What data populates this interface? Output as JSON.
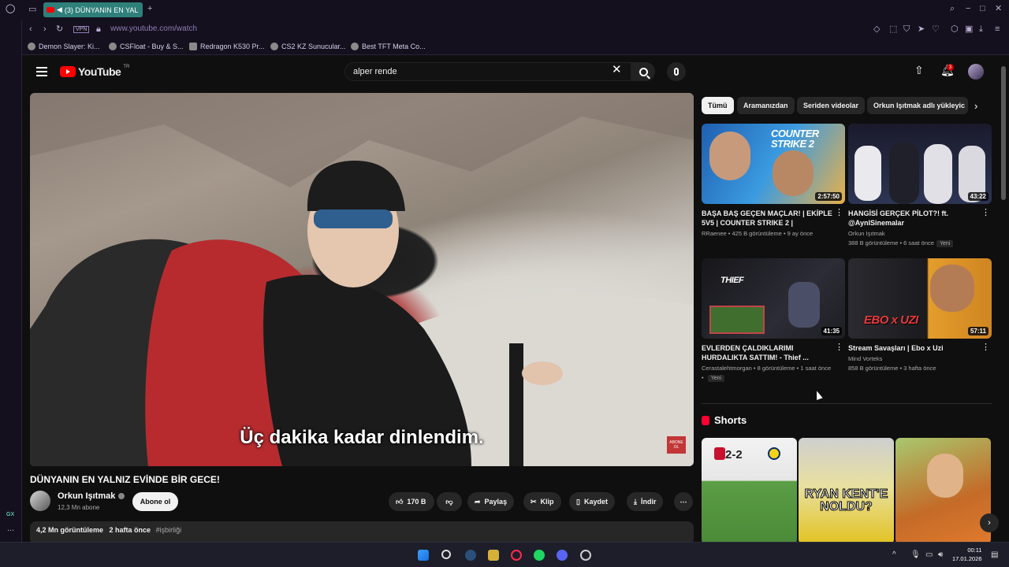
{
  "browser": {
    "tab_title": "(3) DÜNYANIN EN YAL",
    "address": "www.youtube.com/watch",
    "vpn_label": "VPN",
    "bookmarks": [
      "Demon Slayer: Ki...",
      "CSFloat - Buy & S...",
      "Redragon K530 Pr...",
      "CS2 KZ Sunucular...",
      "Best TFT Meta Co..."
    ],
    "gx_label": "GX",
    "more_label": "..."
  },
  "header": {
    "logo_text": "YouTube",
    "country": "TR",
    "search_value": "alper rende",
    "notif_count": "3"
  },
  "player": {
    "subtitle": "Üç dakika kadar dinlendim.",
    "watermark": "ABONE OL"
  },
  "video": {
    "title": "DÜNYANIN EN YALNIZ EVİNDE BİR GECE!",
    "channel": "Orkun Işıtmak",
    "subs": "12,3 Mn abone",
    "subscribe": "Abone ol",
    "likes": "170 B",
    "share": "Paylaş",
    "clip": "Klip",
    "save": "Kaydet",
    "download": "İndir",
    "views": "4,2 Mn görüntüleme",
    "age": "2 hafta önce",
    "tag": "#işbirliği"
  },
  "chips": [
    "Tümü",
    "Aramanızdan",
    "Seriden videolar",
    "Orkun Işıtmak adlı yükleyic"
  ],
  "recommendations": [
    {
      "title": "BAŞA BAŞ GEÇEN MAÇLAR! | EKİPLE 5V5 | COUNTER STRIKE 2 |",
      "channel": "RRaenee",
      "meta": "425 B görüntüleme • 9 ay önce",
      "duration": "2:57:50",
      "thumb_text": "COUNTER STRIKE 2",
      "badge": ""
    },
    {
      "title": "HANGİSİ GERÇEK PİLOT?! ft. @AynISinemalar",
      "channel": "Orkun Işıtmak",
      "meta": "388 B görüntüleme • 6 saat önce",
      "duration": "43:22",
      "thumb_text": "",
      "badge": "Yeni"
    },
    {
      "title": "EVLERDEN ÇALDIKLARIMI HURDALIKTA SATTIM! - Thief ...",
      "channel": "Cerastalehtmorgan",
      "meta": "8 görüntüleme • 1 saat önce",
      "duration": "41:35",
      "thumb_text": "THIEF",
      "badge": "Yeni"
    },
    {
      "title": "Stream Savaşları | Ebo x Uzi",
      "channel": "Mind Vorteks",
      "meta": "858 B görüntüleme • 3 hafta önce",
      "duration": "57:11",
      "thumb_text": "EBO x UZI",
      "badge": ""
    }
  ],
  "shorts": {
    "heading": "Shorts",
    "items": [
      {
        "text": "2-2"
      },
      {
        "text": "RYAN KENT'E NOLDU?"
      },
      {
        "text": ""
      }
    ]
  },
  "taskbar": {
    "time": "00:11",
    "date": "17.01.2026"
  },
  "colors": {
    "yt_red": "#ff0000",
    "tab_teal": "#2f7f7a",
    "background": "#0f0f0f"
  }
}
